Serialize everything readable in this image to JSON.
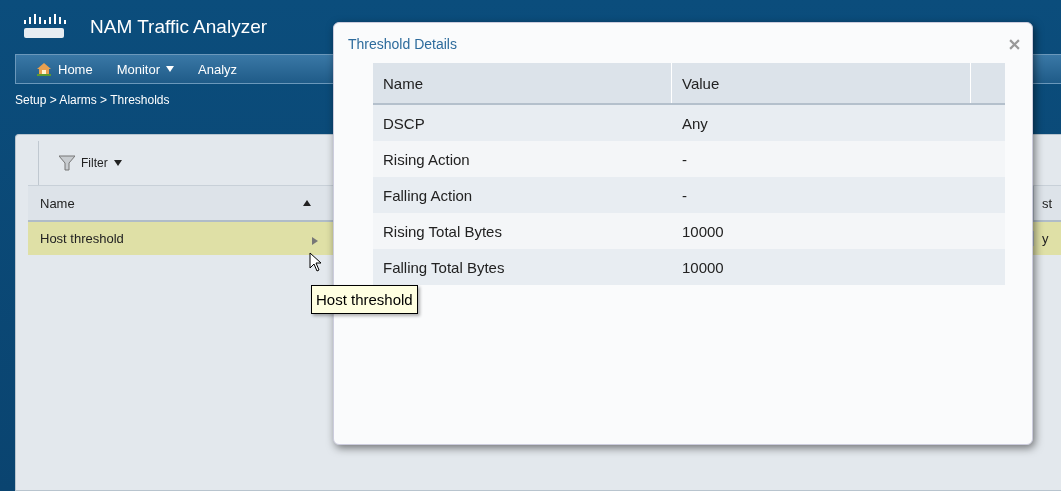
{
  "app": {
    "title": "NAM Traffic Analyzer"
  },
  "nav": [
    {
      "label": "Home",
      "kind": "home"
    },
    {
      "label": "Monitor",
      "kind": "menu"
    },
    {
      "label": "Analyz",
      "kind": "plain"
    }
  ],
  "breadcrumb": "Setup > Alarms > Thresholds",
  "toolbar": {
    "filter": "Filter"
  },
  "table": {
    "columns": [
      {
        "label": "Name",
        "sorted": true
      },
      {
        "label": "st",
        "sorted": false
      }
    ],
    "rows": [
      {
        "cells": [
          "Host threshold",
          "y"
        ],
        "selected": true
      }
    ]
  },
  "tooltip": "Host threshold",
  "dialog": {
    "title": "Threshold Details",
    "columns": [
      "Name",
      "Value"
    ],
    "rows": [
      [
        "DSCP",
        "Any"
      ],
      [
        "Rising Action",
        "-"
      ],
      [
        "Falling Action",
        "-"
      ],
      [
        "Rising Total Bytes",
        "10000"
      ],
      [
        "Falling Total Bytes",
        "10000"
      ]
    ]
  }
}
